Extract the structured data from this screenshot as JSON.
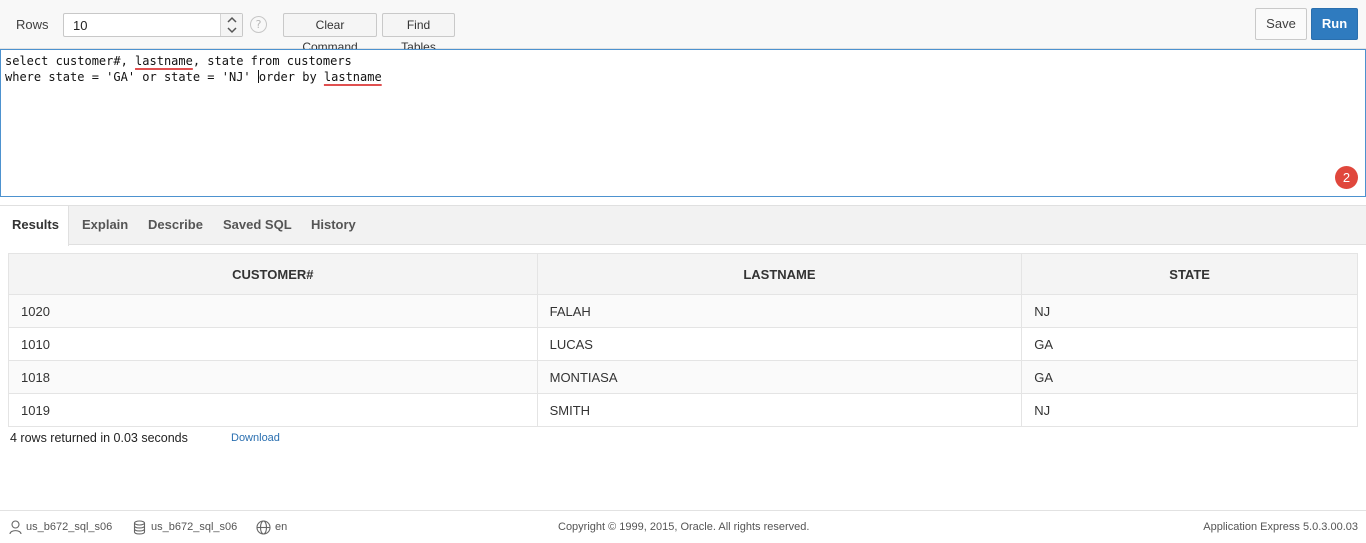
{
  "toolbar": {
    "rows_label": "Rows",
    "rows_value": "10",
    "help_glyph": "?",
    "clear_command_label": "Clear Command",
    "find_tables_label": "Find Tables",
    "save_label": "Save",
    "run_label": "Run"
  },
  "editor": {
    "line1": {
      "pre": "select customer#, ",
      "underlined": "lastname",
      "post": ", state from customers"
    },
    "line2": {
      "pre": "where state = 'GA' or state = 'NJ' ",
      "post": "order by ",
      "underlined": "lastname"
    },
    "error_count": "2"
  },
  "tabs": [
    {
      "label": "Results",
      "active": true
    },
    {
      "label": "Explain"
    },
    {
      "label": "Describe"
    },
    {
      "label": "Saved SQL"
    },
    {
      "label": "History"
    }
  ],
  "results": {
    "columns": [
      "CUSTOMER#",
      "LASTNAME",
      "STATE"
    ],
    "rows": [
      [
        "1020",
        "FALAH",
        "NJ"
      ],
      [
        "1010",
        "LUCAS",
        "GA"
      ],
      [
        "1018",
        "MONTIASA",
        "GA"
      ],
      [
        "1019",
        "SMITH",
        "NJ"
      ]
    ],
    "summary": "4 rows returned in 0.03 seconds",
    "download_label": "Download"
  },
  "footer": {
    "user": "us_b672_sql_s06",
    "schema": "us_b672_sql_s06",
    "language": "en",
    "copyright": "Copyright © 1999, 2015, Oracle. All rights reserved.",
    "version": "Application Express 5.0.3.00.03"
  },
  "colors": {
    "run_button": "#2f7bbf",
    "editor_border": "#4d92cf",
    "error_badge": "#e0473c",
    "link": "#2a6fb0"
  }
}
